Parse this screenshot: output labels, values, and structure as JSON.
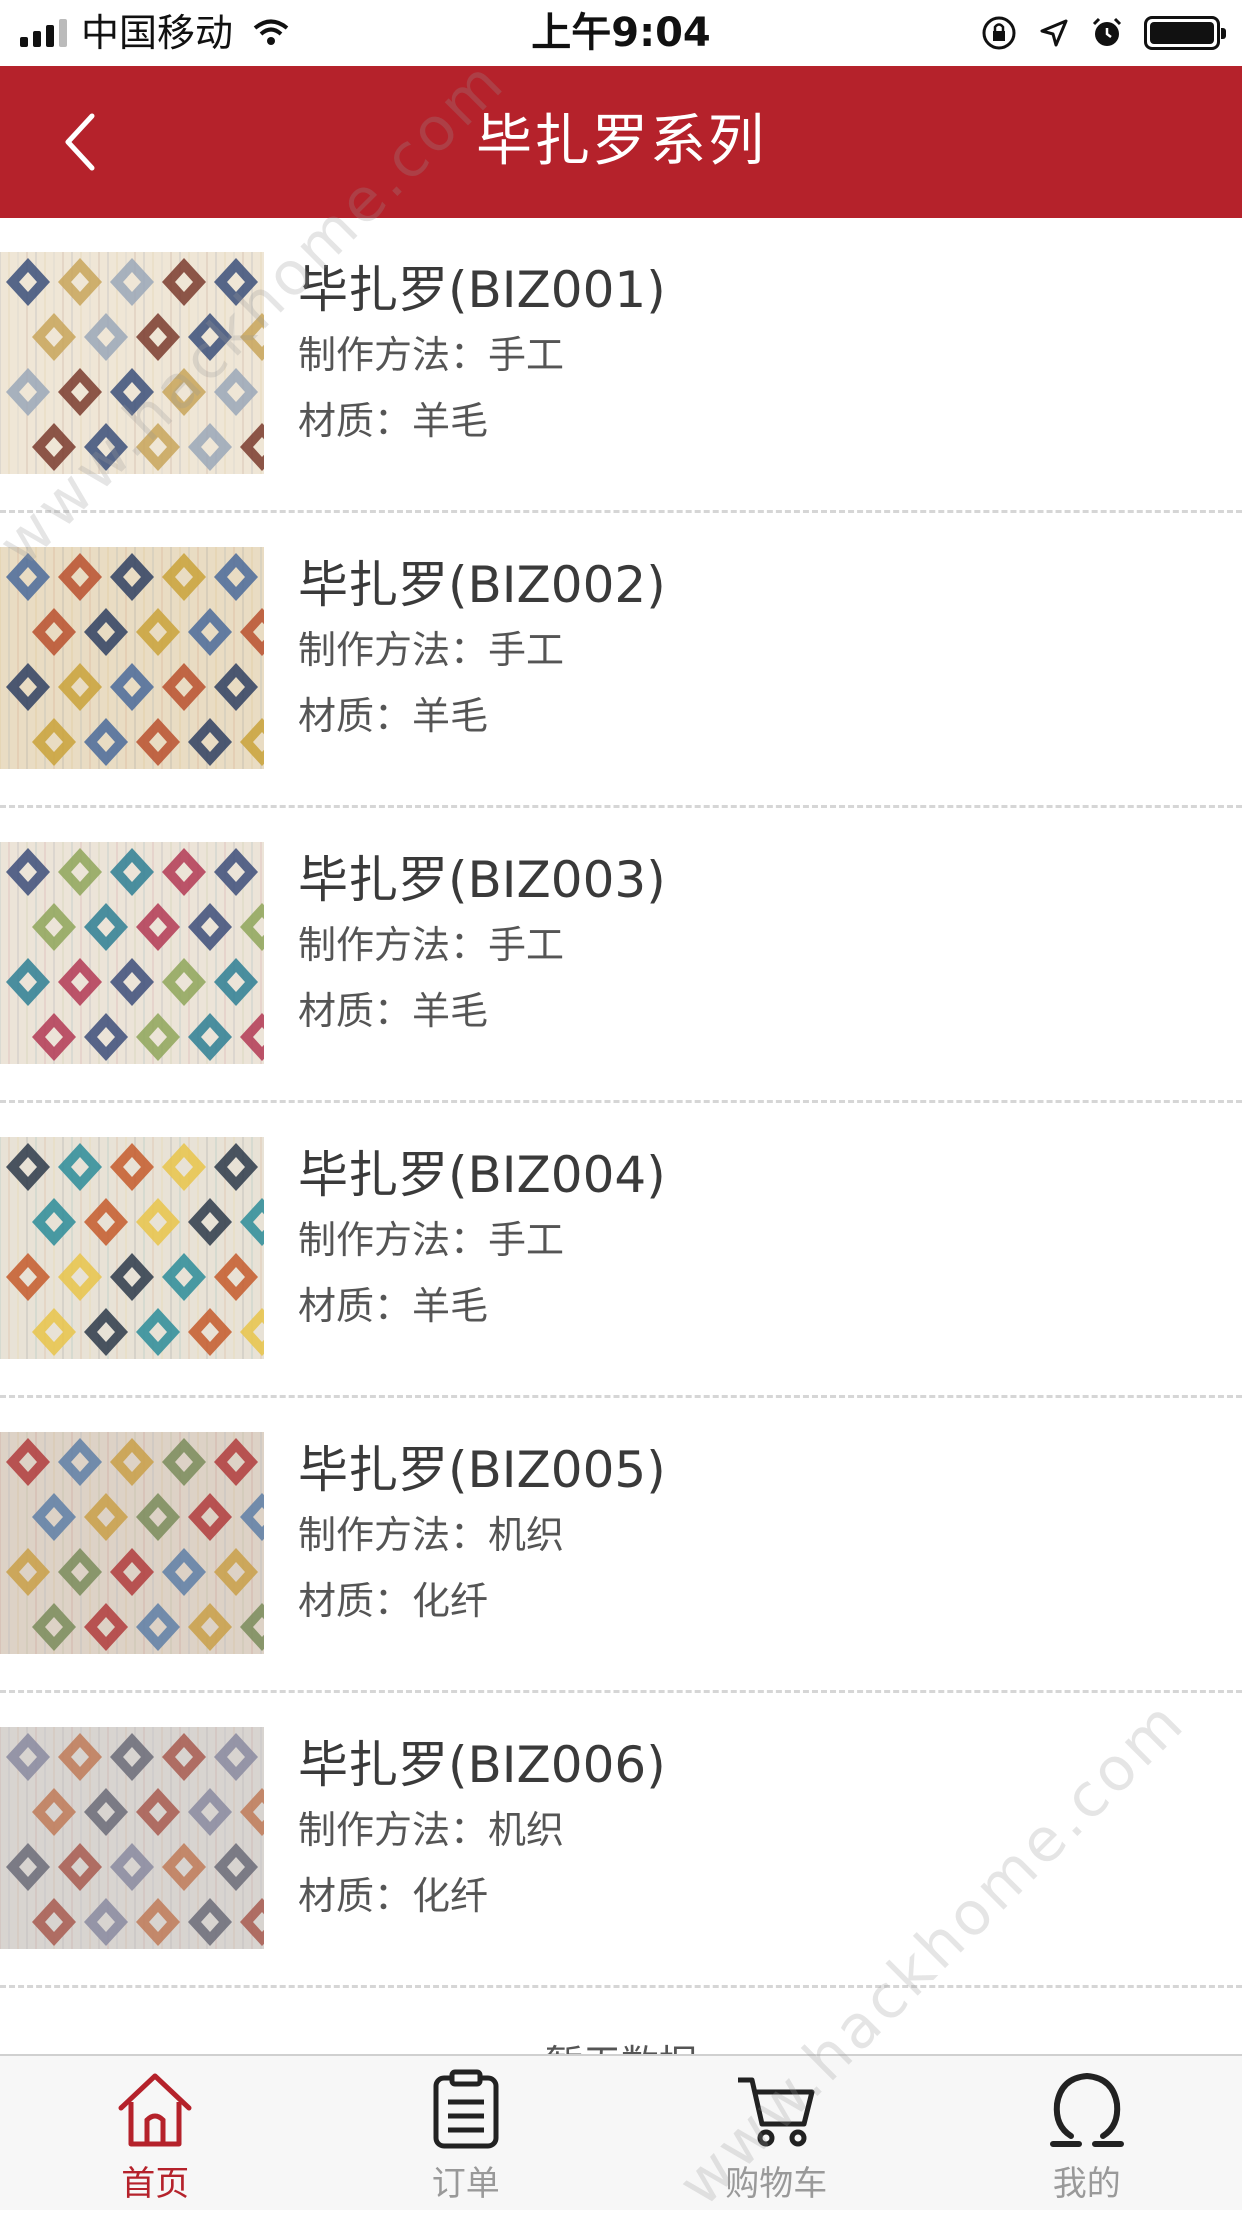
{
  "status_bar": {
    "carrier": "中国移动",
    "time": "上午9:04"
  },
  "navbar": {
    "title": "毕扎罗系列",
    "back_icon": "chevron-left-icon"
  },
  "products": [
    {
      "title": "毕扎罗(BIZ001)",
      "method": "制作方法：手工",
      "material": "材质：羊毛"
    },
    {
      "title": "毕扎罗(BIZ002)",
      "method": "制作方法：手工",
      "material": "材质：羊毛"
    },
    {
      "title": "毕扎罗(BIZ003)",
      "method": "制作方法：手工",
      "material": "材质：羊毛"
    },
    {
      "title": "毕扎罗(BIZ004)",
      "method": "制作方法：手工",
      "material": "材质：羊毛"
    },
    {
      "title": "毕扎罗(BIZ005)",
      "method": "制作方法：机织",
      "material": "材质：化纤"
    },
    {
      "title": "毕扎罗(BIZ006)",
      "method": "制作方法：机织",
      "material": "材质：化纤"
    }
  ],
  "load_more": "暂无数据",
  "tabs": [
    {
      "label": "首页",
      "icon": "home-icon",
      "active": true
    },
    {
      "label": "订单",
      "icon": "clipboard-icon",
      "active": false
    },
    {
      "label": "购物车",
      "icon": "cart-icon",
      "active": false
    },
    {
      "label": "我的",
      "icon": "profile-icon",
      "active": false
    }
  ],
  "colors": {
    "brand_red": "#b5222b",
    "tab_inactive": "#999999"
  },
  "watermark": "www.hackhome.com"
}
